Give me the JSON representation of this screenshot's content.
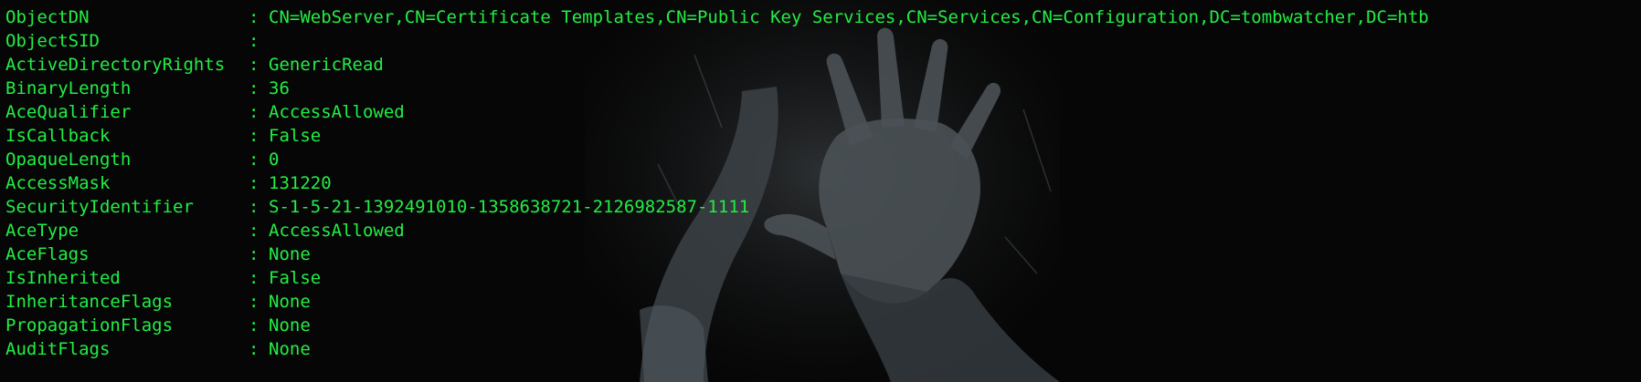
{
  "terminal": {
    "text_color": "#22ee44",
    "background_color": "#060606",
    "separator": ":",
    "rows": [
      {
        "key": "ObjectDN",
        "value": "CN=WebServer,CN=Certificate Templates,CN=Public Key Services,CN=Services,CN=Configuration,DC=tombwatcher,DC=htb"
      },
      {
        "key": "ObjectSID",
        "value": ""
      },
      {
        "key": "ActiveDirectoryRights",
        "value": "GenericRead"
      },
      {
        "key": "BinaryLength",
        "value": "36"
      },
      {
        "key": "AceQualifier",
        "value": "AccessAllowed"
      },
      {
        "key": "IsCallback",
        "value": "False"
      },
      {
        "key": "OpaqueLength",
        "value": "0"
      },
      {
        "key": "AccessMask",
        "value": "131220"
      },
      {
        "key": "SecurityIdentifier",
        "value": "S-1-5-21-1392491010-1358638721-2126982587-1111"
      },
      {
        "key": "AceType",
        "value": "AccessAllowed"
      },
      {
        "key": "AceFlags",
        "value": "None"
      },
      {
        "key": "IsInherited",
        "value": "False"
      },
      {
        "key": "InheritanceFlags",
        "value": "None"
      },
      {
        "key": "PropagationFlags",
        "value": "None"
      },
      {
        "key": "AuditFlags",
        "value": "None"
      }
    ]
  },
  "background": {
    "icon": "raised-hand-wallpaper-icon"
  }
}
